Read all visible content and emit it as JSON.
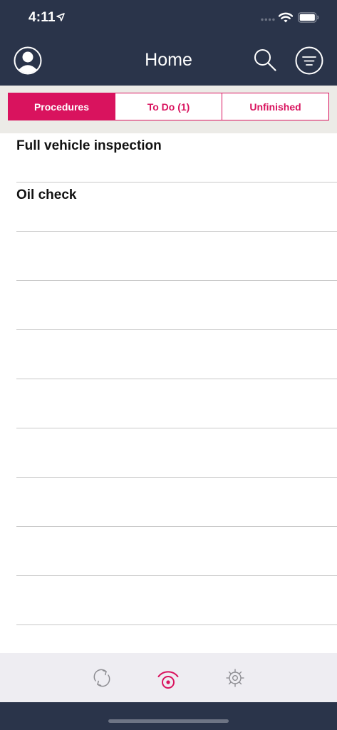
{
  "status_bar": {
    "time": "4:11"
  },
  "header": {
    "title": "Home"
  },
  "tabs": [
    {
      "label": "Procedures",
      "active": true
    },
    {
      "label": "To Do (1)",
      "active": false
    },
    {
      "label": "Unfinished",
      "active": false
    }
  ],
  "procedures": [
    {
      "label": "Full vehicle inspection"
    },
    {
      "label": "Oil check"
    },
    {
      "label": ""
    },
    {
      "label": ""
    },
    {
      "label": ""
    },
    {
      "label": ""
    },
    {
      "label": ""
    },
    {
      "label": ""
    },
    {
      "label": ""
    },
    {
      "label": ""
    }
  ],
  "bottom_tabs": [
    {
      "icon": "sync-icon",
      "active": false
    },
    {
      "icon": "scan-icon",
      "active": true
    },
    {
      "icon": "gear-icon",
      "active": false
    }
  ],
  "colors": {
    "header_bg": "#2a344a",
    "accent": "#d9135e",
    "tab_strip_bg": "#ecebe7",
    "bottom_bar_bg": "#eeedf2"
  }
}
